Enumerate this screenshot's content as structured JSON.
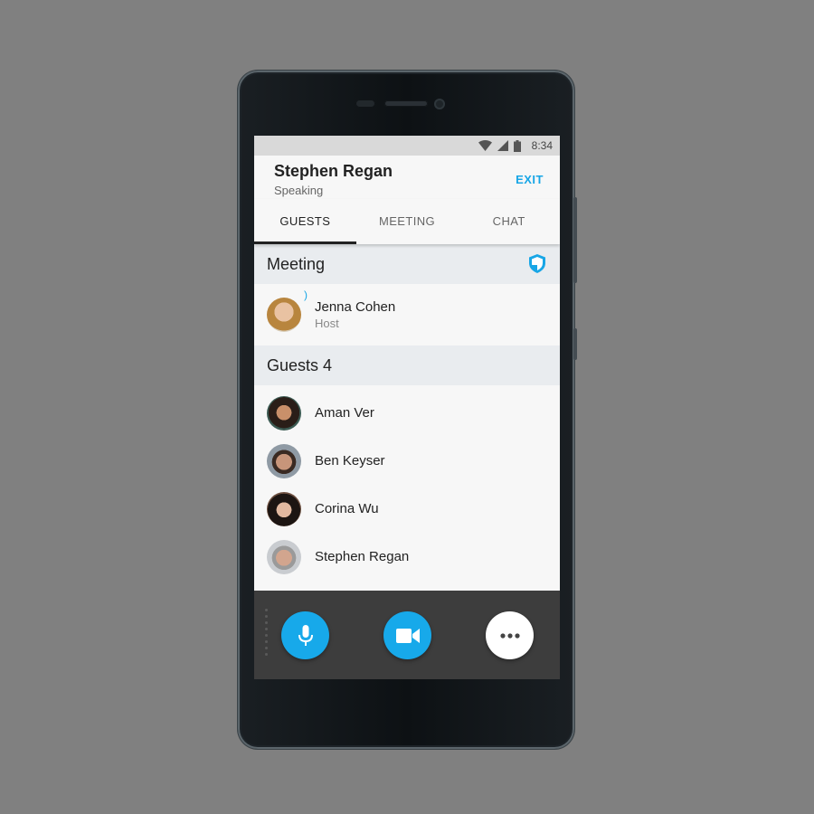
{
  "status_bar": {
    "time": "8:34",
    "icons": [
      "wifi-icon",
      "signal-icon",
      "battery-icon"
    ]
  },
  "header": {
    "caller_name": "Stephen Regan",
    "caller_status": "Speaking",
    "exit_label": "EXIT"
  },
  "tabs": [
    {
      "label": "GUESTS",
      "active": true
    },
    {
      "label": "MEETING",
      "active": false
    },
    {
      "label": "CHAT",
      "active": false
    }
  ],
  "meeting_section": {
    "title": "Meeting",
    "icon": "shield-icon",
    "host": {
      "name": "Jenna Cohen",
      "role": "Host"
    }
  },
  "guests_section": {
    "title": "Guests",
    "count": "4",
    "guests": [
      {
        "name": "Aman Ver"
      },
      {
        "name": "Ben Keyser"
      },
      {
        "name": "Corina Wu"
      },
      {
        "name": "Stephen Regan"
      }
    ]
  },
  "controls": {
    "buttons": [
      "microphone-icon",
      "video-camera-icon",
      "more-options-icon"
    ]
  },
  "colors": {
    "accent": "#18a6e6",
    "section_bg": "#e9ecef",
    "control_bar": "#3d3d3d",
    "background": "#808080"
  }
}
